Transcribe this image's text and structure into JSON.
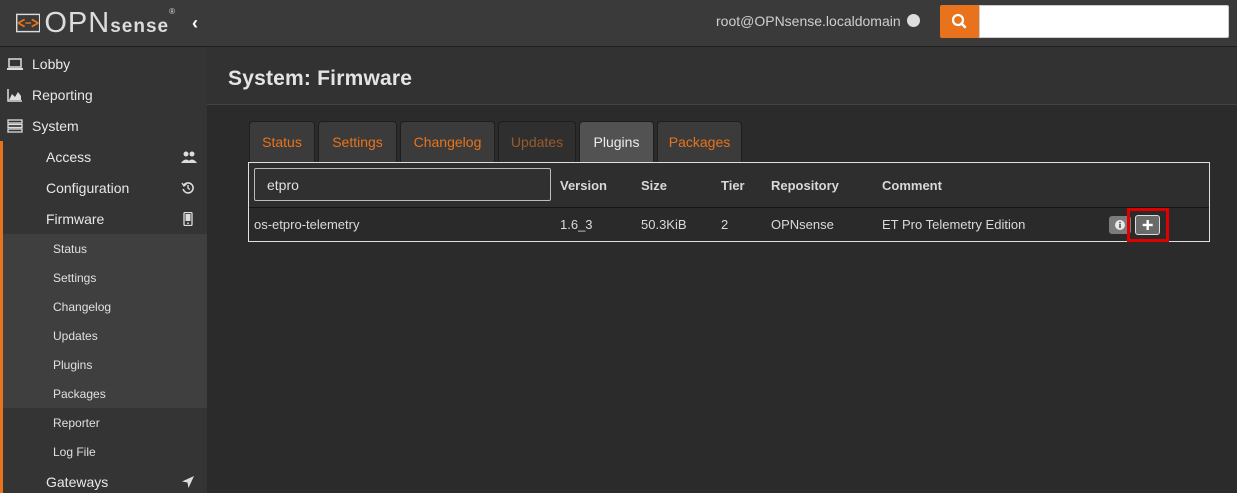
{
  "header": {
    "logo_text": "OPN",
    "logo_sense": "sense",
    "logo_reg": "®",
    "collapse_glyph": "‹",
    "user": "root@OPNsense.localdomain",
    "search_icon": "search-icon",
    "search_placeholder": ""
  },
  "sidebar": {
    "items": [
      {
        "label": "Lobby",
        "icon": "laptop-icon"
      },
      {
        "label": "Reporting",
        "icon": "area-chart-icon"
      },
      {
        "label": "System",
        "icon": "server-icon"
      }
    ],
    "system_sub": [
      {
        "label": "Access",
        "icon": "users-icon"
      },
      {
        "label": "Configuration",
        "icon": "history-icon"
      },
      {
        "label": "Firmware",
        "icon": "tablet-icon"
      }
    ],
    "firmware_sub": [
      "Status",
      "Settings",
      "Changelog",
      "Updates",
      "Plugins",
      "Packages",
      "Reporter",
      "Log File"
    ],
    "gateways": {
      "label": "Gateways",
      "icon": "location-arrow-icon"
    }
  },
  "page": {
    "title": "System: Firmware"
  },
  "tabs": [
    {
      "label": "Status",
      "state": "normal"
    },
    {
      "label": "Settings",
      "state": "normal"
    },
    {
      "label": "Changelog",
      "state": "normal"
    },
    {
      "label": "Updates",
      "state": "disabled"
    },
    {
      "label": "Plugins",
      "state": "active"
    },
    {
      "label": "Packages",
      "state": "normal"
    }
  ],
  "grid": {
    "filter_value": "etpro",
    "columns": [
      "Version",
      "Size",
      "Tier",
      "Repository",
      "Comment"
    ],
    "rows": [
      {
        "name": "os-etpro-telemetry",
        "version": "1.6_3",
        "size": "50.3KiB",
        "tier": "2",
        "repository": "OPNsense",
        "comment": "ET Pro Telemetry Edition"
      }
    ]
  },
  "colors": {
    "accent": "#e8731c",
    "highlight": "#e00000"
  }
}
